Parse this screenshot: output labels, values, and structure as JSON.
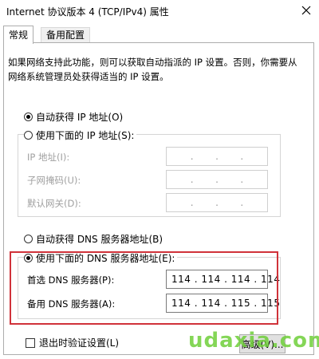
{
  "window": {
    "title": "Internet 协议版本 4 (TCP/IPv4) 属性"
  },
  "tabs": [
    {
      "label": "常规"
    },
    {
      "label": "备用配置"
    }
  ],
  "description": "如果网络支持此功能，则可以获取自动指派的 IP 设置。否则，你需要从网络系统管理员处获得适当的 IP 设置。",
  "ip_section": {
    "auto_label": "自动获得 IP 地址(O)",
    "manual_label": "使用下面的 IP 地址(S):",
    "ip_label": "IP 地址(I):",
    "mask_label": "子网掩码(U):",
    "gateway_label": "默认网关(D):",
    "selected": "auto"
  },
  "dns_section": {
    "auto_label": "自动获得 DNS 服务器地址(B)",
    "manual_label": "使用下面的 DNS 服务器地址(E):",
    "preferred_label": "首选 DNS 服务器(P):",
    "preferred_value": "114 . 114 . 114 . 114",
    "alternate_label": "备用 DNS 服务器(A):",
    "alternate_value": "114 . 114 . 115 . 115",
    "selected": "manual"
  },
  "footer": {
    "validate_label": "退出时验证设置(L)",
    "advanced_label": "高级(V)..."
  },
  "watermark": "udaxia.com",
  "colors": {
    "highlight_border": "#d0323a",
    "watermark": "#6fcf3a"
  }
}
